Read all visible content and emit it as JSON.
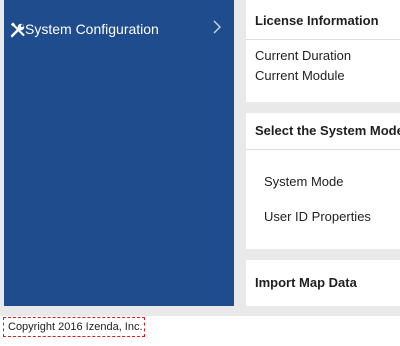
{
  "sidebar": {
    "item_label": "System Configuration",
    "item_icon": "wrench-screwdriver-icon",
    "chevron_icon": "chevron-right-icon"
  },
  "license_card": {
    "title": "License Information",
    "lines": [
      "Current Duration",
      "Current Module"
    ]
  },
  "mode_card": {
    "title": "Select the System Mode",
    "items": [
      "System Mode",
      "User ID Properties"
    ]
  },
  "import_card": {
    "title": "Import Map Data"
  },
  "footer": {
    "copyright": "Copyright 2016 Izenda, Inc."
  },
  "colors": {
    "sidebar_bg": "#1f4c8c",
    "page_bg": "#e9e9ea",
    "card_bg": "#ffffff",
    "highlight_border": "#d42020"
  }
}
